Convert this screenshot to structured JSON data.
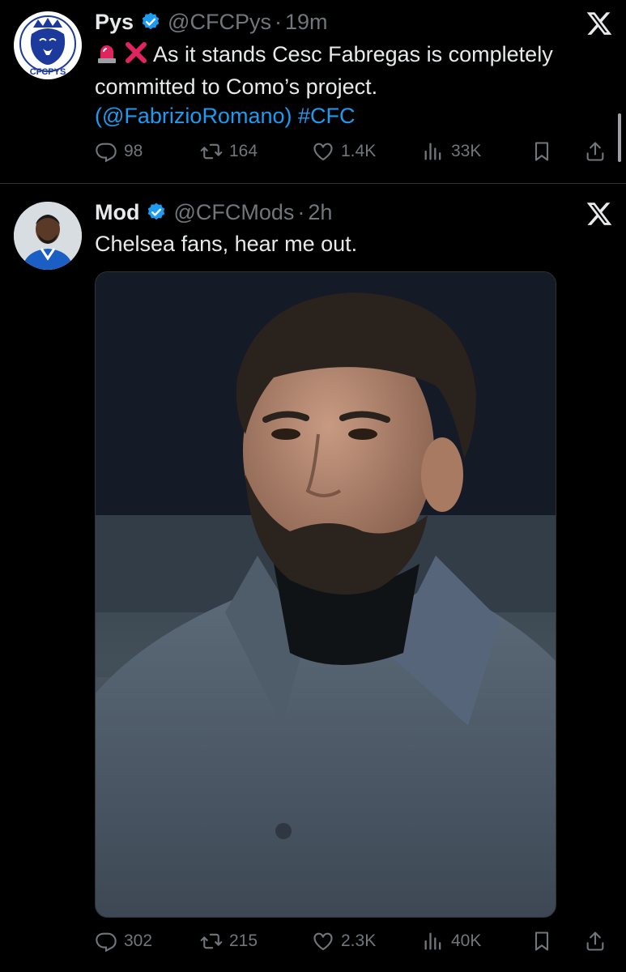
{
  "colors": {
    "background": "#000000",
    "text": "#e7e9ea",
    "secondary": "#71767b",
    "link": "#1d9bf0",
    "verified": "#1d9bf0",
    "divider": "#2f3336"
  },
  "tweets": [
    {
      "name": "Pys",
      "handle": "@CFCPys",
      "separator": "·",
      "time": "19m",
      "avatar_text": "CFCPYS",
      "text": {
        "line1": "As it stands Cesc Fabregas is completely",
        "line2": "committed to Como’s project.",
        "paren_open": "(",
        "mention": "@FabrizioRomano",
        "paren_close": ")",
        "hashtag": "#CFC"
      },
      "emojis": [
        "siren-emoji",
        "cross-mark-emoji"
      ],
      "stats": {
        "replies": "98",
        "retweets": "164",
        "likes": "1.4K",
        "views": "33K"
      }
    },
    {
      "name": "Mod",
      "handle": "@CFCMods",
      "separator": "·",
      "time": "2h",
      "text": {
        "line1": "Chelsea fans, hear me out."
      },
      "stats": {
        "replies": "302",
        "retweets": "215",
        "likes": "2.3K",
        "views": "40K"
      }
    }
  ]
}
